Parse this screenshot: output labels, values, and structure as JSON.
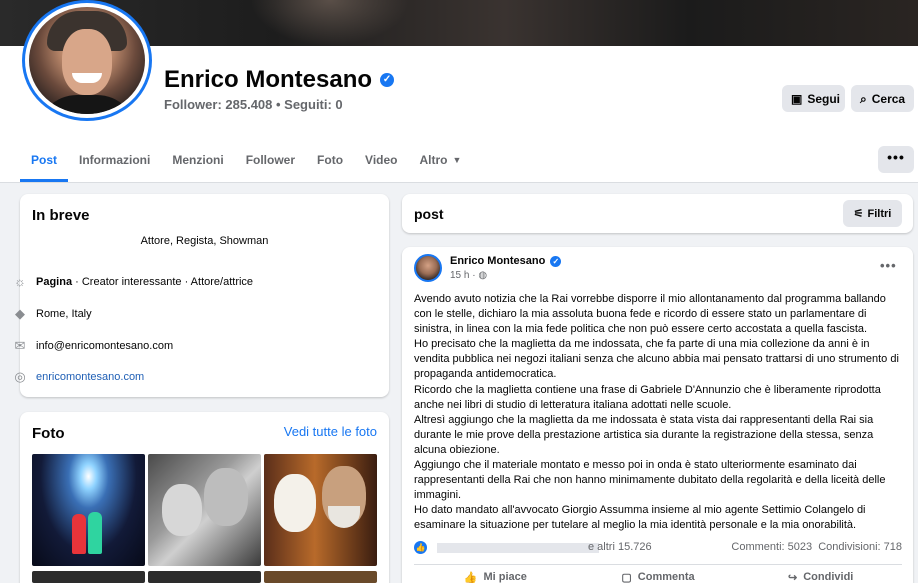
{
  "profile": {
    "name": "Enrico Montesano",
    "verified_mark": "✓",
    "stats": "Follower: 285.408 • Seguiti: 0"
  },
  "actions": {
    "follow_label": "Segui",
    "search_label": "Cerca",
    "more_label": "•••"
  },
  "tabs": [
    {
      "label": "Post"
    },
    {
      "label": "Informazioni"
    },
    {
      "label": "Menzioni"
    },
    {
      "label": "Follower"
    },
    {
      "label": "Foto"
    },
    {
      "label": "Video"
    },
    {
      "label": "Altro"
    }
  ],
  "intro": {
    "title": "In breve",
    "bio": "Attore, Regista, Showman",
    "page_type_bold": "Pagina",
    "page_type_rest": " · Creator interessante · Attore/attrice",
    "location": "Rome, Italy",
    "email": "info@enricomontesano.com",
    "website": "enricomontesano.com"
  },
  "photos": {
    "title": "Foto",
    "see_all": "Vedi tutte le foto"
  },
  "posts_header": {
    "title": "post",
    "filter_label": "Filtri"
  },
  "post": {
    "author": "Enrico Montesano",
    "time": "15 h",
    "paragraphs": [
      "Avendo avuto notizia che la Rai vorrebbe disporre il mio allontanamento dal programma ballando con le stelle, dichiaro la mia assoluta buona fede e ricordo di essere stato un parlamentare di sinistra, in linea con la mia fede politica che non può essere certo accostata a quella fascista.",
      "Ho precisato che la maglietta da me indossata, che fa parte di una mia collezione da anni è in vendita pubblica nei negozi italiani senza che alcuno abbia mai pensato trattarsi di uno strumento di propaganda antidemocratica.",
      "Ricordo che la maglietta contiene una frase di Gabriele D'Annunzio che è liberamente riprodotta anche nei libri di studio di letteratura italiana adottati nelle scuole.",
      "Altresì aggiungo che la maglietta da me indossata è stata vista dai rappresentanti della Rai sia durante le mie prove della prestazione artistica sia durante la registrazione della stessa, senza alcuna obiezione.",
      "Aggiungo che il materiale montato e messo poi in onda è stato ulteriormente esaminato dai rappresentanti della Rai che non hanno minimamente dubitato della regolarità e della liceità delle immagini.",
      "Ho dato mandato all'avvocato Giorgio Assumma insieme al mio agente Settimio Colangelo di esaminare la situazione per tutelare al meglio la mia identità personale e la mia onorabilità."
    ],
    "reactions_others": "e altri 15.726",
    "counts": "Commenti: 5023  Condivisioni: 718",
    "like_label": "Mi piace",
    "comment_label": "Commenta",
    "share_label": "Condividi"
  },
  "colors": {
    "accent": "#1877f2",
    "background": "#f0f2f5",
    "card": "#ffffff",
    "button_gray": "#e4e6eb",
    "secondary_text": "#65676b"
  },
  "icons": [
    "verified-icon",
    "follow-icon",
    "search-icon",
    "more-icon",
    "caret-down-icon",
    "page-icon",
    "location-icon",
    "email-icon",
    "globe-icon",
    "filter-icon",
    "globe-small-icon",
    "like-reaction-icon",
    "like-icon",
    "comment-icon",
    "share-icon"
  ]
}
